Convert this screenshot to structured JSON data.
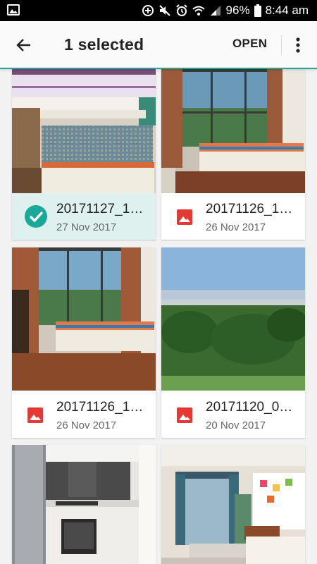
{
  "status_bar": {
    "battery": "96%",
    "time": "8:44 am"
  },
  "app_bar": {
    "title": "1 selected",
    "open_label": "OPEN"
  },
  "files": [
    {
      "name": "20171127_1…",
      "date": "27 Nov 2017",
      "selected": true
    },
    {
      "name": "20171126_1…",
      "date": "26 Nov 2017",
      "selected": false
    },
    {
      "name": "20171126_1…",
      "date": "26 Nov 2017",
      "selected": false
    },
    {
      "name": "20171120_0…",
      "date": "20 Nov 2017",
      "selected": false
    },
    {
      "name": "",
      "date": "",
      "selected": false
    },
    {
      "name": "",
      "date": "",
      "selected": false
    }
  ],
  "colors": {
    "accent": "#1ba89a",
    "image_icon": "#e53935",
    "selected_bg": "#dff1ef"
  }
}
